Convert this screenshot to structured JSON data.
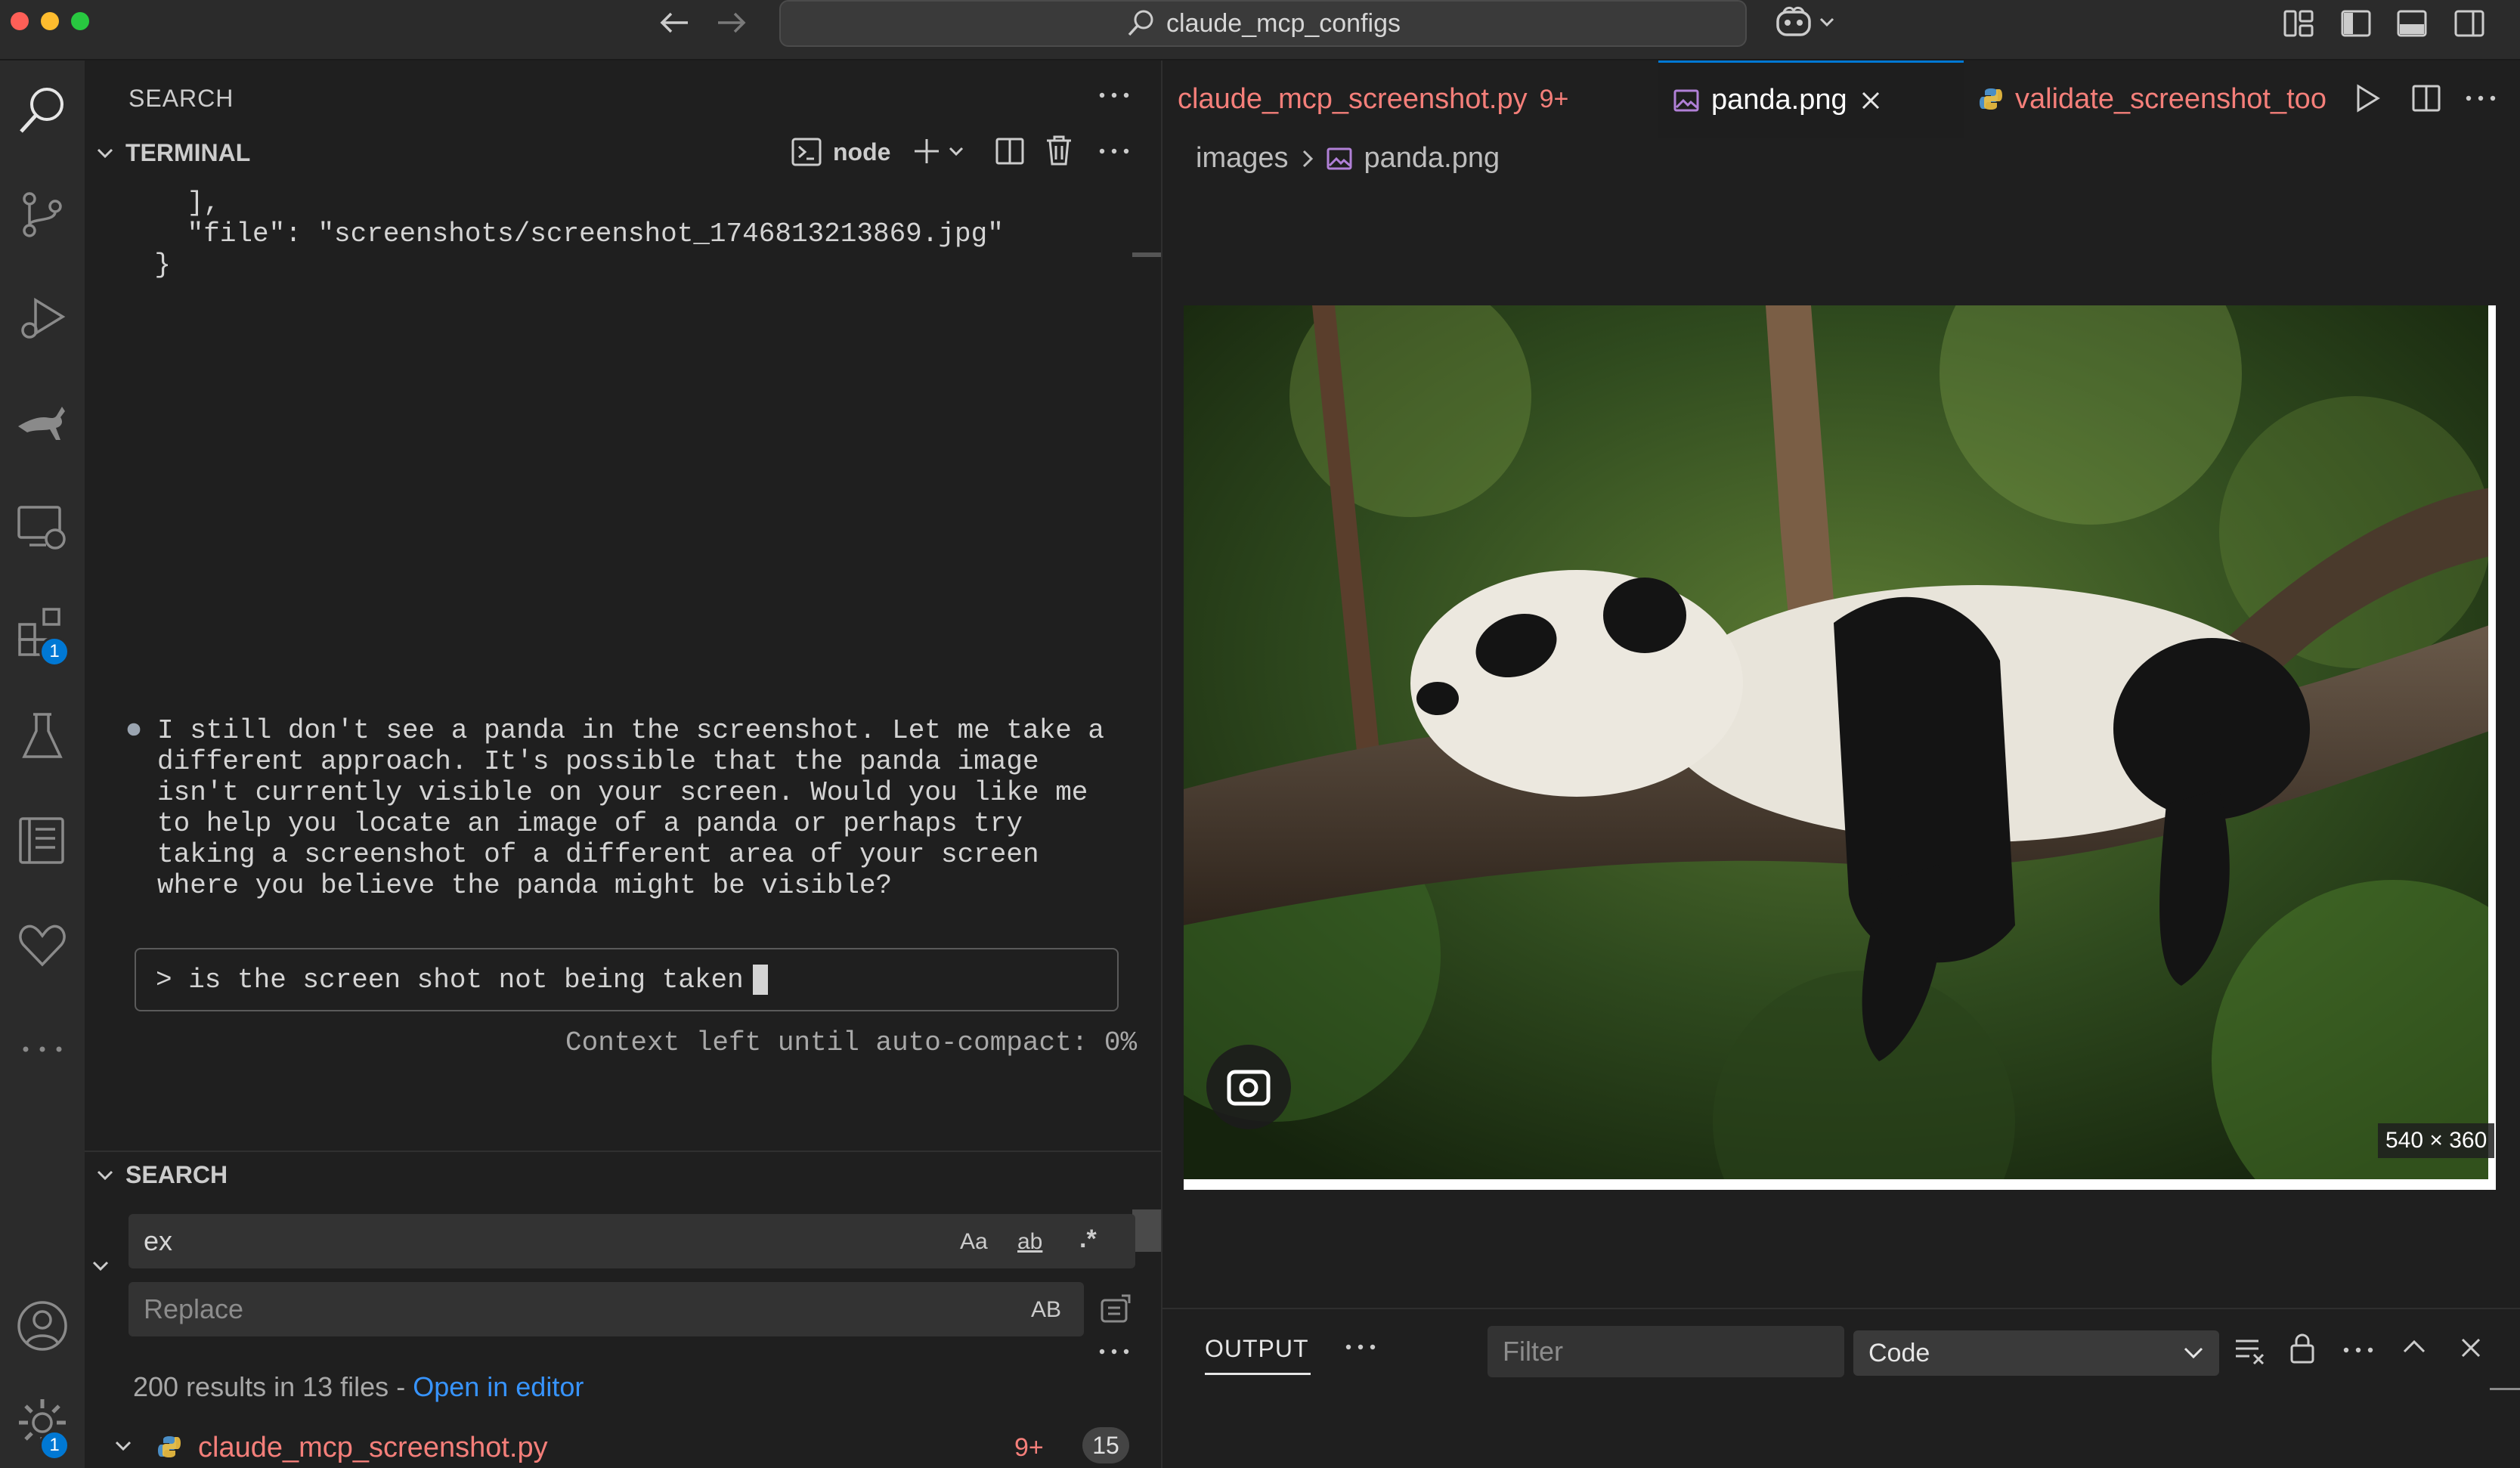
{
  "titlebar": {
    "search_text": "claude_mcp_configs"
  },
  "activity": {
    "extensions_badge": "1",
    "settings_badge": "1"
  },
  "panel": {
    "title": "SEARCH",
    "terminal_section": "TERMINAL",
    "terminal_profile": "node",
    "terminal_lines": [
      "      ],",
      "      \"file\": \"screenshots/screenshot_1746813213869.jpg\"",
      "    }"
    ],
    "assistant_marker": "⏺",
    "assistant_text": "I still don't see a panda in the screenshot. Let me take a\ndifferent approach. It's possible that the panda image\nisn't currently visible on your screen. Would you like me\nto help you locate an image of a panda or perhaps try\ntaking a screenshot of a different area of your screen\nwhere you believe the panda might be visible?",
    "prompt_text": "> is the screen shot not being taken",
    "context_text": "Context left until auto-compact: 0%"
  },
  "search": {
    "section": "SEARCH",
    "query": "ex",
    "replace_placeholder": "Replace",
    "match_case": "Aa",
    "whole_word": "ab",
    "regex": ".*",
    "preserve_case": "AB",
    "summary": "200 results in 13 files - ",
    "open_link": "Open in editor",
    "result_file": "claude_mcp_screenshot.py",
    "result_problems": "9+",
    "result_count": "15"
  },
  "tabs": [
    {
      "label": "claude_mcp_screenshot.py",
      "badge": "9+"
    },
    {
      "label": "panda.png"
    },
    {
      "label": "validate_screenshot_too"
    }
  ],
  "breadcrumb": {
    "folder": "images",
    "file": "panda.png"
  },
  "image": {
    "dimensions": "540 × 360"
  },
  "output": {
    "tab": "OUTPUT",
    "filter_placeholder": "Filter",
    "channel": "Code"
  },
  "colors": {
    "accent": "#0078d4",
    "error_text": "#f57f7a",
    "link": "#3794ff"
  }
}
